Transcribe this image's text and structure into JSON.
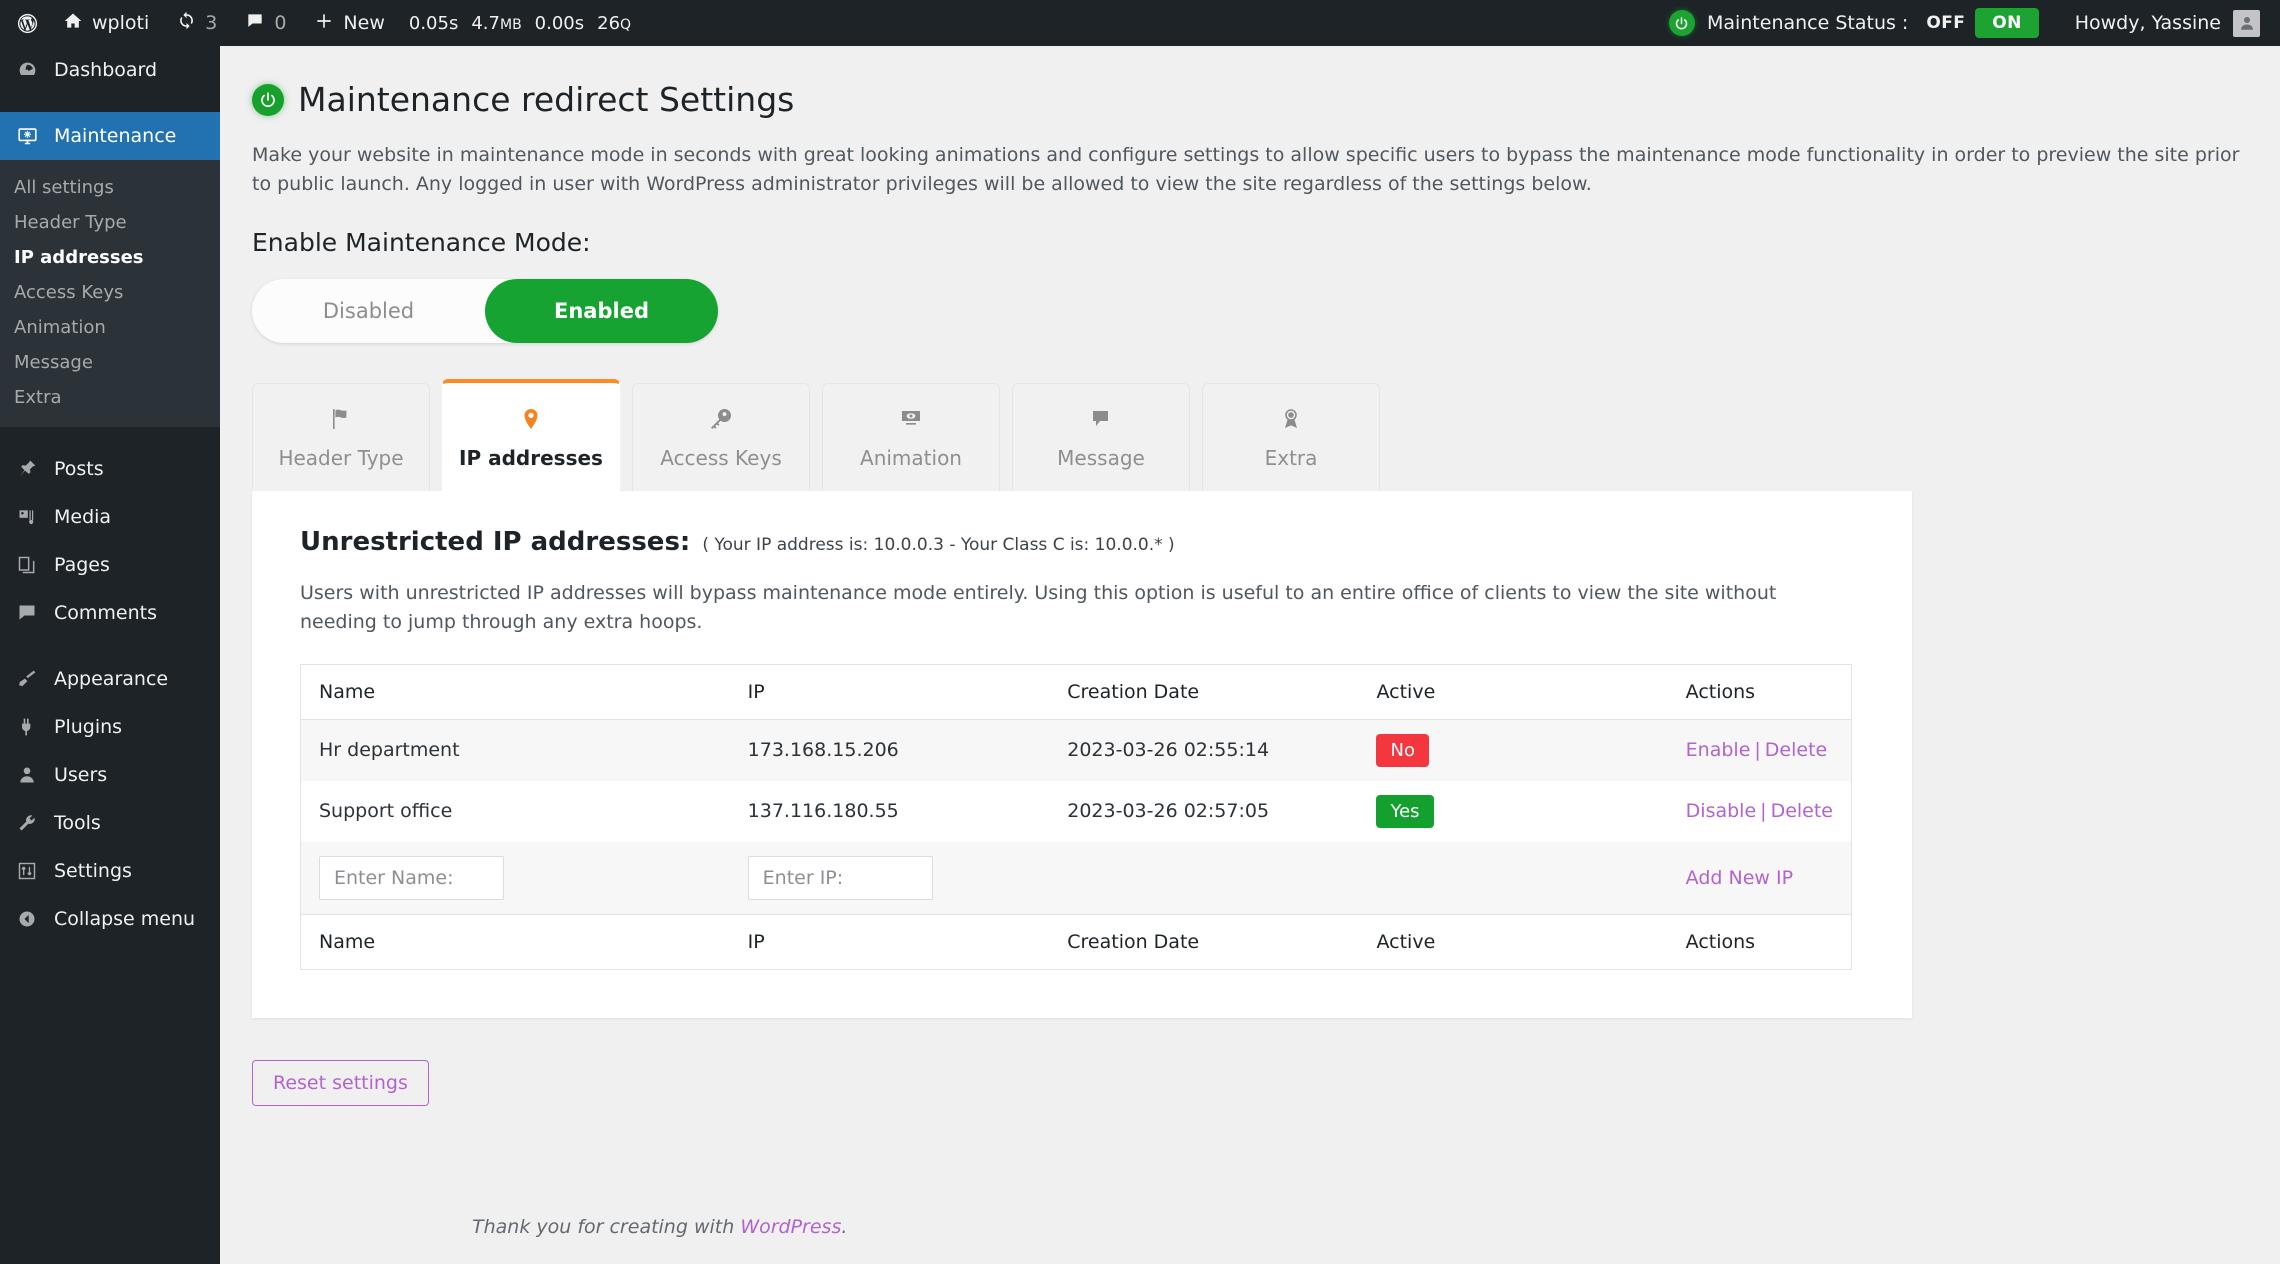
{
  "adminbar": {
    "logo_icon": "wordpress-logo-icon",
    "site_icon": "home-icon",
    "site_name": "wploti",
    "updates_icon": "updates-icon",
    "updates_count": "3",
    "comments_icon": "comment-bubble-icon",
    "comments_count": "0",
    "new_icon": "plus-icon",
    "new_label": "New",
    "perf_time": "0.05s",
    "perf_memory": "4.7",
    "perf_memory_unit": "MB",
    "perf_db_time": "0.00s",
    "perf_queries": "26",
    "perf_queries_unit": "Q",
    "maintenance_power_icon": "power-icon",
    "maintenance_status_label": "Maintenance Status :",
    "status_off": "OFF",
    "status_on": "ON",
    "howdy": "Howdy, Yassine",
    "avatar_icon": "user-avatar-icon"
  },
  "sidebar": {
    "items": [
      {
        "label": "Dashboard",
        "icon": "dashboard-icon",
        "key": "dashboard"
      },
      {
        "label": "Maintenance",
        "icon": "maintenance-screen-icon",
        "key": "maintenance"
      },
      {
        "label": "Posts",
        "icon": "pin-icon",
        "key": "posts"
      },
      {
        "label": "Media",
        "icon": "media-icon",
        "key": "media"
      },
      {
        "label": "Pages",
        "icon": "pages-icon",
        "key": "pages"
      },
      {
        "label": "Comments",
        "icon": "comment-bubble-icon",
        "key": "comments"
      },
      {
        "label": "Appearance",
        "icon": "paintbrush-icon",
        "key": "appearance"
      },
      {
        "label": "Plugins",
        "icon": "plug-icon",
        "key": "plugins"
      },
      {
        "label": "Users",
        "icon": "user-icon",
        "key": "users"
      },
      {
        "label": "Tools",
        "icon": "wrench-icon",
        "key": "tools"
      },
      {
        "label": "Settings",
        "icon": "sliders-icon",
        "key": "settings"
      },
      {
        "label": "Collapse menu",
        "icon": "collapse-arrow-icon",
        "key": "collapse"
      }
    ],
    "submenu": [
      {
        "label": "All settings",
        "active": false
      },
      {
        "label": "Header Type",
        "active": false
      },
      {
        "label": "IP addresses",
        "active": true
      },
      {
        "label": "Access Keys",
        "active": false
      },
      {
        "label": "Animation",
        "active": false
      },
      {
        "label": "Message",
        "active": false
      },
      {
        "label": "Extra",
        "active": false
      }
    ]
  },
  "page": {
    "title": "Maintenance redirect Settings",
    "title_icon": "power-icon",
    "lede": "Make your website in maintenance mode in seconds with great looking animations and configure settings to allow specific users to bypass the maintenance mode functionality in order to preview the site prior to public launch. Any logged in user with WordPress administrator privileges will be allowed to view the site regardless of the settings below.",
    "enable_heading": "Enable Maintenance Mode:",
    "toggle": {
      "disabled_label": "Disabled",
      "enabled_label": "Enabled",
      "selected": "Enabled"
    },
    "tabs": [
      {
        "label": "Header Type",
        "icon": "flag-icon",
        "active": false
      },
      {
        "label": "IP addresses",
        "icon": "map-pin-icon",
        "active": true
      },
      {
        "label": "Access Keys",
        "icon": "key-icon",
        "active": false
      },
      {
        "label": "Animation",
        "icon": "monitor-eye-icon",
        "active": false
      },
      {
        "label": "Message",
        "icon": "speech-bubble-icon",
        "active": false
      },
      {
        "label": "Extra",
        "icon": "award-ribbon-icon",
        "active": false
      }
    ],
    "panel": {
      "title": "Unrestricted IP addresses:",
      "subtitle": "( Your IP address is: 10.0.0.3 - Your Class C is: 10.0.0.* )",
      "description": "Users with unrestricted IP addresses will bypass maintenance mode entirely. Using this option is useful to an entire office of clients to view the site without needing to jump through any extra hoops.",
      "columns": [
        "Name",
        "IP",
        "Creation Date",
        "Active",
        "Actions"
      ],
      "rows": [
        {
          "name": "Hr department",
          "ip": "173.168.15.206",
          "date": "2023-03-26 02:55:14",
          "active": "No",
          "active_state": "no",
          "action_toggle": "Enable",
          "action_sep": "|",
          "action_delete": "Delete"
        },
        {
          "name": "Support office",
          "ip": "137.116.180.55",
          "date": "2023-03-26 02:57:05",
          "active": "Yes",
          "active_state": "yes",
          "action_toggle": "Disable",
          "action_sep": "|",
          "action_delete": "Delete"
        }
      ],
      "new_row": {
        "name_placeholder": "Enter Name:",
        "name_value": "",
        "ip_placeholder": "Enter IP:",
        "ip_value": "",
        "add_label": "Add New IP"
      }
    },
    "reset_label": "Reset settings"
  },
  "footer": {
    "text_before": "Thank you for creating with ",
    "link": "WordPress",
    "text_after": "."
  },
  "colors": {
    "accent_orange": "#f5821f",
    "green": "#16a331",
    "red": "#f4373f",
    "purple": "#b263cf",
    "admin_blue": "#2271b1",
    "sidebar_bg": "#1d2327",
    "submenu_bg": "#2c3338"
  }
}
